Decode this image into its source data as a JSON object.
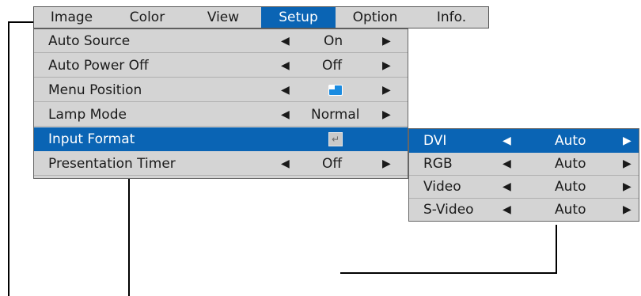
{
  "tabs": [
    {
      "label": "Image",
      "active": false
    },
    {
      "label": "Color",
      "active": false
    },
    {
      "label": "View",
      "active": false
    },
    {
      "label": "Setup",
      "active": true
    },
    {
      "label": "Option",
      "active": false
    },
    {
      "label": "Info.",
      "active": false
    }
  ],
  "setup_menu": {
    "items": [
      {
        "label": "Auto Source",
        "value": "On"
      },
      {
        "label": "Auto Power Off",
        "value": "Off"
      },
      {
        "label": "Menu Position",
        "value_icon": "menu-position-icon"
      },
      {
        "label": "Lamp Mode",
        "value": "Normal"
      },
      {
        "label": "Input Format",
        "value_icon": "enter-icon",
        "selected": true
      },
      {
        "label": "Presentation Timer",
        "value": "Off"
      }
    ]
  },
  "input_format_submenu": {
    "items": [
      {
        "label": "DVI",
        "value": "Auto",
        "selected": true
      },
      {
        "label": "RGB",
        "value": "Auto"
      },
      {
        "label": "Video",
        "value": "Auto"
      },
      {
        "label": "S-Video",
        "value": "Auto"
      }
    ]
  },
  "icons": {
    "left_arrow": "◀",
    "right_arrow": "▶",
    "enter": "↵"
  },
  "colors": {
    "menu_bg": "#d4d4d4",
    "highlight": "#0a64b4",
    "highlight_text": "#ffffff",
    "text": "#1a1a1a"
  }
}
